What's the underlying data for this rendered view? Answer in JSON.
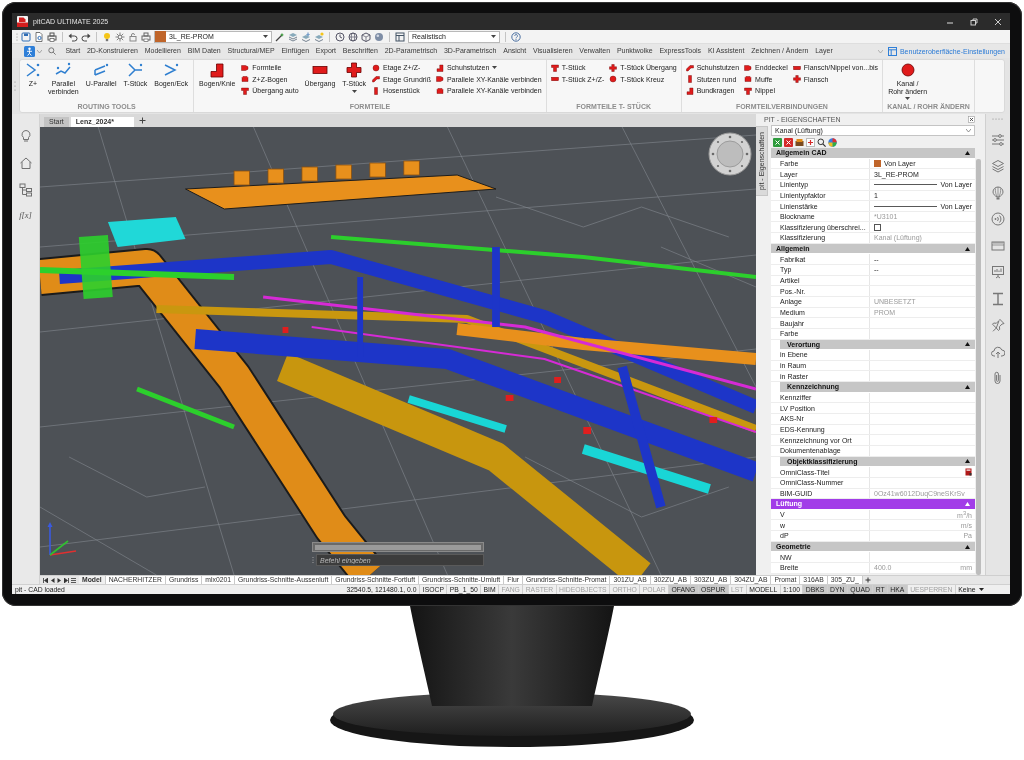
{
  "window": {
    "title": "pitCAD ULTIMATE 2025"
  },
  "quick_access": {
    "layer": {
      "value": "3L_RE-PROM",
      "color": "#c0652a"
    },
    "visual_style": {
      "value": "Realistisch"
    }
  },
  "menu": {
    "tabs": [
      {
        "label": "Start",
        "selected": false
      },
      {
        "label": "2D-Konstruieren",
        "selected": false
      },
      {
        "label": "Modellieren",
        "selected": false
      },
      {
        "label": "BIM Daten",
        "selected": false
      },
      {
        "label": "Structural/MEP",
        "selected": false
      },
      {
        "label": "Einfügen",
        "selected": false
      },
      {
        "label": "Export",
        "selected": false
      },
      {
        "label": "Beschriften",
        "selected": false
      },
      {
        "label": "2D-Parametrisch",
        "selected": false
      },
      {
        "label": "3D-Parametrisch",
        "selected": false
      },
      {
        "label": "Ansicht",
        "selected": false
      },
      {
        "label": "Visualisieren",
        "selected": false
      },
      {
        "label": "Verwalten",
        "selected": false
      },
      {
        "label": "Punktwolke",
        "selected": false
      },
      {
        "label": "ExpressTools",
        "selected": false
      },
      {
        "label": "KI Assistent",
        "selected": false
      },
      {
        "label": "Zeichnen / Ändern",
        "selected": false
      },
      {
        "label": "Layer",
        "selected": false
      }
    ],
    "settings_link": "Benutzeroberfläche-Einstellungen"
  },
  "ribbon": {
    "panels": [
      {
        "title": "ROUTING TOOLS",
        "groups": [
          {
            "kind": "large",
            "label": "Z+",
            "dropdown": false
          },
          {
            "kind": "large",
            "label": "Parallel\nverbinden",
            "dropdown": false
          },
          {
            "kind": "large",
            "label": "U-Parallel",
            "dropdown": false
          },
          {
            "kind": "large",
            "label": "T-Stück",
            "dropdown": false
          },
          {
            "kind": "large",
            "label": "Bogen/Eck",
            "dropdown": false
          }
        ]
      },
      {
        "title": "FORMTEILE",
        "groups": [
          {
            "kind": "large",
            "label": "Bogen/Knie",
            "dropdown": false
          },
          {
            "kind": "stack",
            "items": [
              {
                "label": "Formteile",
                "dropdown": false
              },
              {
                "label": "Z+Z-Bogen",
                "dropdown": false
              },
              {
                "label": "Übergang auto",
                "dropdown": false
              }
            ]
          },
          {
            "kind": "large",
            "label": "Übergang",
            "dropdown": false
          },
          {
            "kind": "large",
            "label": "T-Stück",
            "dropdown": true
          },
          {
            "kind": "stack",
            "items": [
              {
                "label": "Etage Z+/Z-",
                "dropdown": false
              },
              {
                "label": "Etage Grundriß",
                "dropdown": false
              },
              {
                "label": "Hosenstück",
                "dropdown": false
              }
            ]
          },
          {
            "kind": "stack",
            "items": [
              {
                "label": "Schuhstutzen",
                "dropdown": true
              },
              {
                "label": "Parallele XY-Kanäle verbinden",
                "dropdown": false
              },
              {
                "label": "Parallele XY-Kanäle verbinden",
                "dropdown": false
              }
            ]
          }
        ]
      },
      {
        "title": "FORMTEILE T- STÜCK",
        "groups": [
          {
            "kind": "stack",
            "items": [
              {
                "label": "T-Stück",
                "dropdown": false
              },
              {
                "label": "T-Stück Z+/Z-",
                "dropdown": false
              }
            ]
          },
          {
            "kind": "stack",
            "items": [
              {
                "label": "T-Stück Übergang",
                "dropdown": false
              },
              {
                "label": "T-Stück Kreuz",
                "dropdown": false
              }
            ]
          }
        ]
      },
      {
        "title": "FORMTEILVERBINDUNGEN",
        "groups": [
          {
            "kind": "stack",
            "items": [
              {
                "label": "Schuhstutzen",
                "dropdown": false
              },
              {
                "label": "Stutzen rund",
                "dropdown": false
              },
              {
                "label": "Bundkragen",
                "dropdown": false
              }
            ]
          },
          {
            "kind": "stack",
            "items": [
              {
                "label": "Enddeckel",
                "dropdown": false
              },
              {
                "label": "Muffe",
                "dropdown": false
              },
              {
                "label": "Nippel",
                "dropdown": false
              }
            ]
          },
          {
            "kind": "stack",
            "items": [
              {
                "label": "Flansch/Nippel von...bis",
                "dropdown": false
              },
              {
                "label": "Flansch",
                "dropdown": false
              }
            ]
          }
        ]
      },
      {
        "title": "KANAL / ROHR ÄNDERN",
        "groups": [
          {
            "kind": "large",
            "label": "Kanal /\nRohr ändern",
            "dropdown": true
          }
        ]
      }
    ]
  },
  "left_toolbar": {
    "formula_label": "f[x]"
  },
  "document_tabs": [
    {
      "label": "Start",
      "selected": false
    },
    {
      "label": "Lenz_2024*",
      "selected": true
    }
  ],
  "command_line": {
    "placeholder": "Befehl eingeben"
  },
  "layout_tabs": [
    {
      "label": "Model",
      "selected": true
    },
    {
      "label": "NACHERHITZER",
      "selected": false
    },
    {
      "label": "Grundriss",
      "selected": false
    },
    {
      "label": "mlx0201",
      "selected": false
    },
    {
      "label": "Grundriss-Schnitte-Aussenluft",
      "selected": false
    },
    {
      "label": "Grundriss-Schnitte-Fortluft",
      "selected": false
    },
    {
      "label": "Grundriss-Schnitte-Umluft",
      "selected": false
    },
    {
      "label": "Flur",
      "selected": false
    },
    {
      "label": "Grundriss-Schnitte-Promat",
      "selected": false
    },
    {
      "label": "301ZU_AB",
      "selected": false
    },
    {
      "label": "302ZU_AB",
      "selected": false
    },
    {
      "label": "303ZU_AB",
      "selected": false
    },
    {
      "label": "304ZU_AB",
      "selected": false
    },
    {
      "label": "Promat",
      "selected": false
    },
    {
      "label": "316AB",
      "selected": false
    },
    {
      "label": "305_ZU_",
      "selected": false
    }
  ],
  "properties": {
    "title": "PIT - EIGENSCHAFTEN",
    "side_tab": "pit - Eigenschaften",
    "selection": "Kanal (Lüftung)",
    "sections": [
      {
        "title": "Allgemein CAD",
        "color": "#c6c6c6",
        "expanded": true,
        "rows": [
          {
            "label": "Farbe",
            "kind": "color",
            "color": "#c0652a",
            "value": "Von Layer",
            "readonly": false
          },
          {
            "label": "Layer",
            "kind": "text",
            "value": "3L_RE-PROM",
            "readonly": false
          },
          {
            "label": "Linientyp",
            "kind": "line",
            "value": "Von Layer",
            "readonly": false
          },
          {
            "label": "Linientypfaktor",
            "kind": "text",
            "value": "1",
            "readonly": false
          },
          {
            "label": "Linienstärke",
            "kind": "line",
            "value": "Von Layer",
            "readonly": false
          },
          {
            "label": "Blockname",
            "kind": "text",
            "value": "*U3101",
            "readonly": true
          },
          {
            "label": "Klassifizierung überschrei...",
            "kind": "checkbox",
            "checked": false
          },
          {
            "label": "Klassifizierung",
            "kind": "text",
            "value": "Kanal (Lüftung)",
            "readonly": true
          }
        ]
      },
      {
        "title": "Allgemein",
        "color": "#c6c6c6",
        "expanded": true,
        "rows": [
          {
            "label": "Fabrikat",
            "kind": "text",
            "value": "--",
            "readonly": false
          },
          {
            "label": "Typ",
            "kind": "text",
            "value": "--",
            "readonly": false
          },
          {
            "label": "Artikel",
            "kind": "text"
          },
          {
            "label": "Pos.-Nr.",
            "kind": "text"
          },
          {
            "label": "Anlage",
            "kind": "text",
            "value": "UNBESETZT",
            "readonly": true
          },
          {
            "label": "Medium",
            "kind": "text",
            "value": "PROM",
            "readonly": true
          },
          {
            "label": "Baujahr",
            "kind": "text"
          },
          {
            "label": "Farbe",
            "kind": "text"
          }
        ],
        "children": [
          {
            "title": "Verortung",
            "expanded": true,
            "rows": [
              {
                "label": "in Ebene",
                "kind": "text"
              },
              {
                "label": "in Raum",
                "kind": "text"
              },
              {
                "label": "in Raster",
                "kind": "text"
              }
            ]
          },
          {
            "title": "Kennzeichnung",
            "expanded": true,
            "rows": [
              {
                "label": "Kennziffer",
                "kind": "text"
              },
              {
                "label": "LV Position",
                "kind": "text"
              },
              {
                "label": "AKS-Nr",
                "kind": "text"
              },
              {
                "label": "EDS-Kennung",
                "kind": "text"
              },
              {
                "label": "Kennzeichnung vor Ort",
                "kind": "text"
              },
              {
                "label": "Dokumentenablage",
                "kind": "text"
              }
            ]
          },
          {
            "title": "Objektklassifizierung",
            "expanded": true,
            "rows": [
              {
                "label": "OmniClass-Titel",
                "kind": "icon"
              },
              {
                "label": "OmniClass-Nummer",
                "kind": "text"
              },
              {
                "label": "BIM-GUID",
                "kind": "text",
                "value": "0Oz41w6012DuqC9neSKrSv",
                "readonly": true
              }
            ]
          }
        ]
      },
      {
        "title": "Lüftung",
        "color": "#a23de8",
        "expanded": true,
        "rows": [
          {
            "label": "V",
            "kind": "unit",
            "unit": "m$^{3}$/h",
            "readonly": true
          },
          {
            "label": "w",
            "kind": "unit",
            "unit": "m/s",
            "readonly": true
          },
          {
            "label": "dP",
            "kind": "unit",
            "unit": "Pa",
            "readonly": true
          }
        ]
      },
      {
        "title": "Geometrie",
        "color": "#c6c6c6",
        "expanded": true,
        "rows": [
          {
            "label": "NW",
            "kind": "text"
          },
          {
            "label": "Breite",
            "kind": "unit",
            "value": "400.0",
            "unit": "mm",
            "readonly": true
          }
        ]
      }
    ]
  },
  "status_bar": {
    "message": "pit - CAD loaded",
    "coordinates": "32540.5, 121480.1, 0.0",
    "items": [
      {
        "label": "ISOCP",
        "kind": "label"
      },
      {
        "label": "PB_1_50",
        "kind": "label"
      },
      {
        "label": "BIM",
        "kind": "label"
      },
      {
        "label": "FANG",
        "kind": "toggle",
        "on": false
      },
      {
        "label": "RASTER",
        "kind": "toggle",
        "on": false
      },
      {
        "label": "HIDEOBJECTS",
        "kind": "toggle",
        "on": false
      },
      {
        "label": "ORTHO",
        "kind": "toggle",
        "on": false
      },
      {
        "label": "POLAR",
        "kind": "toggle",
        "on": false
      },
      {
        "label": "OFANG",
        "kind": "toggle",
        "on": true
      },
      {
        "label": "OSPUR",
        "kind": "toggle",
        "on": true
      },
      {
        "label": "LST",
        "kind": "toggle",
        "on": false
      },
      {
        "label": "MODELL",
        "kind": "label"
      },
      {
        "label": "1:100",
        "kind": "label"
      },
      {
        "label": "DBKS",
        "kind": "toggle",
        "on": true
      },
      {
        "label": "DYN",
        "kind": "toggle",
        "on": true
      },
      {
        "label": "QUAD",
        "kind": "toggle",
        "on": true
      },
      {
        "label": "RT",
        "kind": "toggle",
        "on": true
      },
      {
        "label": "HKA",
        "kind": "toggle",
        "on": true
      },
      {
        "label": "UESPERREN",
        "kind": "toggle",
        "on": false
      },
      {
        "label": "Keine",
        "kind": "dropdown"
      }
    ]
  }
}
